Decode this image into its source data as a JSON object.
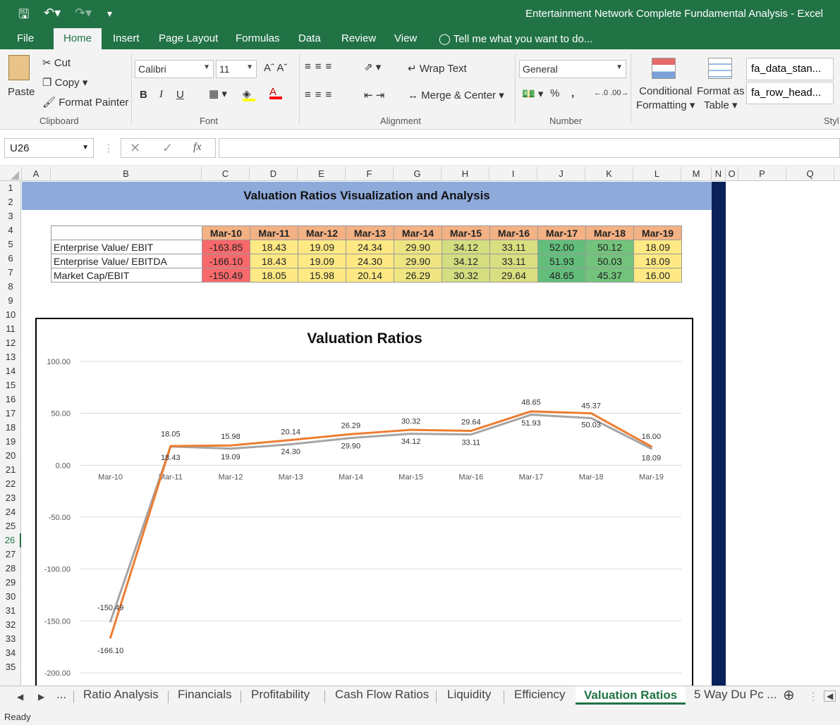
{
  "window": {
    "title": "Entertainment Network Complete Fundamental Analysis - Excel"
  },
  "ribbon_tabs": [
    "File",
    "Home",
    "Insert",
    "Page Layout",
    "Formulas",
    "Data",
    "Review",
    "View"
  ],
  "tell_me": "Tell me what you want to do...",
  "clipboard": {
    "paste": "Paste",
    "cut": "Cut",
    "copy": "Copy",
    "format_painter": "Format Painter",
    "label": "Clipboard"
  },
  "font": {
    "name": "Calibri",
    "size": "11",
    "label": "Font",
    "bold": "B",
    "italic": "I",
    "underline": "U"
  },
  "alignment": {
    "wrap": "Wrap Text",
    "merge": "Merge & Center",
    "label": "Alignment"
  },
  "number": {
    "format": "General",
    "percent": "%",
    "comma": ",",
    "label": "Number"
  },
  "styles": {
    "conditional_1": "Conditional",
    "conditional_2": "Formatting",
    "format_as_1": "Format as",
    "format_as_2": "Table",
    "style1": "fa_data_stan...",
    "style2": "fa_row_head...",
    "label": "Styl"
  },
  "formula_bar": {
    "name_box": "U26",
    "fx": "fx",
    "formula": ""
  },
  "columns": [
    "A",
    "B",
    "C",
    "D",
    "E",
    "F",
    "G",
    "H",
    "I",
    "J",
    "K",
    "L",
    "M",
    "N",
    "O",
    "P",
    "Q"
  ],
  "rows": [
    "1",
    "2",
    "3",
    "4",
    "5",
    "6",
    "7",
    "8",
    "9",
    "10",
    "11",
    "12",
    "13",
    "14",
    "15",
    "16",
    "17",
    "18",
    "19",
    "20",
    "21",
    "22",
    "23",
    "24",
    "25",
    "26",
    "27",
    "28",
    "29",
    "30",
    "31",
    "32",
    "33",
    "34",
    "35"
  ],
  "selected_row": "26",
  "sheet_title": "Valuation Ratios Visualization and Analysis",
  "table": {
    "headers": [
      "Mar-10",
      "Mar-11",
      "Mar-12",
      "Mar-13",
      "Mar-14",
      "Mar-15",
      "Mar-16",
      "Mar-17",
      "Mar-18",
      "Mar-19"
    ],
    "rows": [
      {
        "label": "Enterprise Value/ EBIT",
        "values": [
          "-163.85",
          "18.43",
          "19.09",
          "24.34",
          "29.90",
          "34.12",
          "33.11",
          "52.00",
          "50.12",
          "18.09"
        ]
      },
      {
        "label": "Enterprise Value/ EBITDA",
        "values": [
          "-166.10",
          "18.43",
          "19.09",
          "24.30",
          "29.90",
          "34.12",
          "33.11",
          "51.93",
          "50.03",
          "18.09"
        ]
      },
      {
        "label": "Market Cap/EBIT",
        "values": [
          "-150.49",
          "18.05",
          "15.98",
          "20.14",
          "26.29",
          "30.32",
          "29.64",
          "48.65",
          "45.37",
          "16.00"
        ]
      }
    ],
    "colors": {
      "header": "#f4b183",
      "col": [
        "#f8696b",
        "#ffe984",
        "#ffe984",
        "#fde883",
        "#eee582",
        "#d4dd80",
        "#d9df80",
        "#63be7b",
        "#73c37c",
        "#ffe984"
      ]
    }
  },
  "chart_data": {
    "type": "line",
    "title": "Valuation Ratios",
    "categories": [
      "Mar-10",
      "Mar-11",
      "Mar-12",
      "Mar-13",
      "Mar-14",
      "Mar-15",
      "Mar-16",
      "Mar-17",
      "Mar-18",
      "Mar-19"
    ],
    "yticks": [
      "100.00",
      "50.00",
      "0.00",
      "-50.00",
      "-100.00",
      "-150.00",
      "-200.00"
    ],
    "ylim": [
      -200,
      100
    ],
    "series": [
      {
        "values": [
          -166.1,
          18.43,
          19.09,
          24.3,
          29.9,
          34.12,
          33.11,
          51.93,
          50.03,
          18.09
        ],
        "color": "#ed7d31"
      },
      {
        "values": [
          -150.49,
          18.05,
          15.98,
          20.14,
          26.29,
          30.32,
          29.64,
          48.65,
          45.37,
          16.0
        ],
        "color": "#a5a5a5"
      }
    ],
    "labels_above": [
      "-150.49",
      "18.05",
      "15.98",
      "20.14",
      "26.29",
      "30.32",
      "29.64",
      "48.65",
      "45.37",
      "16.00"
    ],
    "labels_below": [
      "-166.10",
      "18.43",
      "19.09",
      "24.30",
      "29.90",
      "34.12",
      "33.11",
      "51.93",
      "50.03",
      "18.09"
    ],
    "grid": true,
    "legend": "none"
  },
  "sheet_tabs": [
    "...",
    "Ratio Analysis",
    "Financials",
    "Profitability",
    "Cash Flow Ratios",
    "Liquidity",
    "Efficiency",
    "Valuation Ratios",
    "5 Way Du Pc ..."
  ],
  "active_sheet": "Valuation Ratios",
  "status": "Ready"
}
